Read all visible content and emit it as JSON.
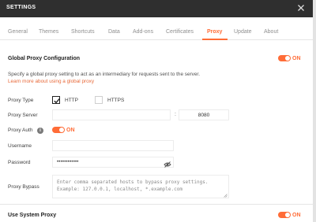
{
  "window": {
    "title": "SETTINGS"
  },
  "tabs": [
    {
      "label": "General"
    },
    {
      "label": "Themes"
    },
    {
      "label": "Shortcuts"
    },
    {
      "label": "Data"
    },
    {
      "label": "Add-ons"
    },
    {
      "label": "Certificates"
    },
    {
      "label": "Proxy",
      "active": true
    },
    {
      "label": "Update"
    },
    {
      "label": "About"
    }
  ],
  "global_proxy": {
    "title": "Global Proxy Configuration",
    "toggle_label": "ON",
    "description": "Specify a global proxy setting to act as an intermediary for requests sent to the server.",
    "learn_more": "Learn more about using a global proxy",
    "proxy_type_label": "Proxy Type",
    "http_label": "HTTP",
    "http_checked": true,
    "https_label": "HTTPS",
    "https_checked": false,
    "proxy_server_label": "Proxy Server",
    "server_value": "",
    "port_separator": ":",
    "port_value": "8080",
    "proxy_auth_label": "Proxy Auth",
    "auth_toggle_label": "ON",
    "username_label": "Username",
    "username_value": "",
    "password_label": "Password",
    "password_value": "••••••••••••",
    "bypass_label": "Proxy Bypass",
    "bypass_placeholder_line1": "Enter comma separated hosts to bypass proxy settings.",
    "bypass_placeholder_line2": "Example: 127.0.0.1, localhost, *.example.com"
  },
  "system_proxy": {
    "title": "Use System Proxy",
    "toggle_label": "ON"
  },
  "colors": {
    "accent": "#ff6c37",
    "titlebar": "#2f2f2f"
  },
  "icons": {
    "close": "close-icon",
    "info": "info-icon",
    "eye": "eye-slash-icon"
  }
}
